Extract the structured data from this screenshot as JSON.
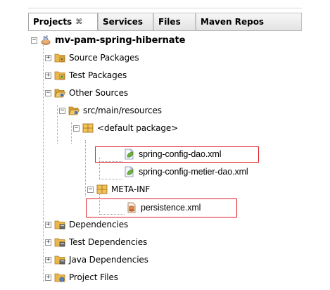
{
  "tabs": [
    {
      "label": "Projects",
      "close": "⌘",
      "active": true
    },
    {
      "label": "Services",
      "active": false
    },
    {
      "label": "Files",
      "active": false
    },
    {
      "label": "Maven Repos",
      "active": false
    }
  ],
  "tree": {
    "root": {
      "label": "mv-pam-spring-hibernate",
      "expander": "−"
    },
    "source_packages": {
      "label": "Source Packages",
      "expander": "+"
    },
    "test_packages": {
      "label": "Test Packages",
      "expander": "+"
    },
    "other_sources": {
      "label": "Other Sources",
      "expander": "−"
    },
    "resources": {
      "label": "src/main/resources",
      "expander": "−"
    },
    "default_package": {
      "label": "<default package>",
      "expander": "−"
    },
    "spring_config_dao": {
      "label": "spring-config-dao.xml"
    },
    "spring_config_metier_dao": {
      "label": "spring-config-metier-dao.xml"
    },
    "meta_inf": {
      "label": "META-INF",
      "expander": "−"
    },
    "persistence": {
      "label": "persistence.xml"
    },
    "dependencies": {
      "label": "Dependencies",
      "expander": "+"
    },
    "test_dependencies": {
      "label": "Test Dependencies",
      "expander": "+"
    },
    "java_dependencies": {
      "label": "Java Dependencies",
      "expander": "+"
    },
    "project_files": {
      "label": "Project Files",
      "expander": "+"
    }
  },
  "colors": {
    "highlight": "#e0202a",
    "folder": "#e9b74a",
    "package": "#e5b34a"
  }
}
